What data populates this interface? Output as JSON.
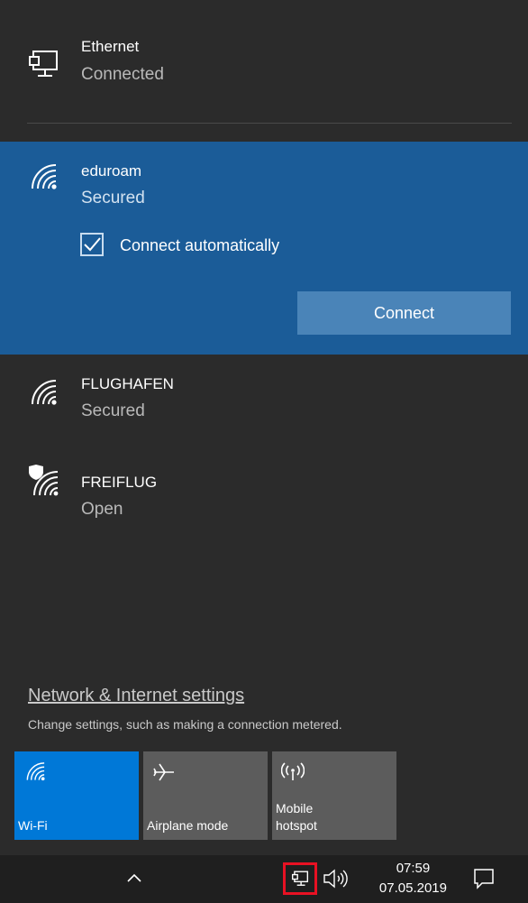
{
  "ethernet": {
    "name": "Ethernet",
    "status": "Connected"
  },
  "networks": [
    {
      "name": "eduroam",
      "status": "Secured"
    },
    {
      "name": "FLUGHAFEN",
      "status": "Secured"
    },
    {
      "name": "FREIFLUG",
      "status": "Open"
    }
  ],
  "selected_network": {
    "auto_connect_label": "Connect automatically",
    "auto_connect_checked": true,
    "connect_label": "Connect"
  },
  "settings": {
    "link": "Network & Internet settings",
    "description": "Change settings, such as making a connection metered."
  },
  "quick_actions": [
    {
      "label": "Wi-Fi",
      "active": true,
      "icon": "wifi-icon"
    },
    {
      "label": "Airplane mode",
      "active": false,
      "icon": "airplane-icon"
    },
    {
      "label_line1": "Mobile",
      "label_line2": "hotspot",
      "active": false,
      "icon": "hotspot-icon"
    }
  ],
  "taskbar": {
    "time": "07:59",
    "date": "07.05.2019"
  },
  "colors": {
    "accent": "#1b5c98",
    "tile_active": "#0078d7",
    "tile_inactive": "#5c5c5c",
    "highlight_box": "#e81123"
  }
}
